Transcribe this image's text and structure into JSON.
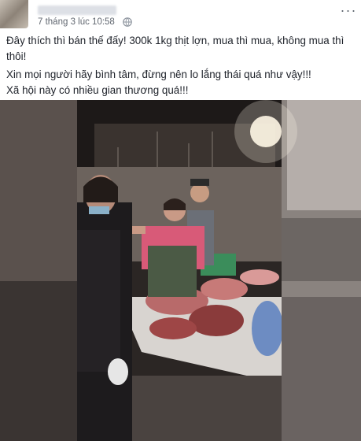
{
  "post": {
    "timestamp": "7 tháng 3 lúc 10:58",
    "more_label": "···",
    "paragraphs": [
      "Đây thích thì bán thế đấy! 300k 1kg thịt lợn, mua thì mua, không mua thì thôi!",
      "Xin mọi người hãy bình tâm, đừng nên lo lắng thái quá như vậy!!!",
      "Xã hội này có nhiều gian thương quá!!!"
    ]
  },
  "icons": {
    "privacy": "globe-icon",
    "more": "more-options-icon"
  },
  "colors": {
    "timestamp": "#616770",
    "text": "#1d2129",
    "video_bg": "#2a2523"
  }
}
